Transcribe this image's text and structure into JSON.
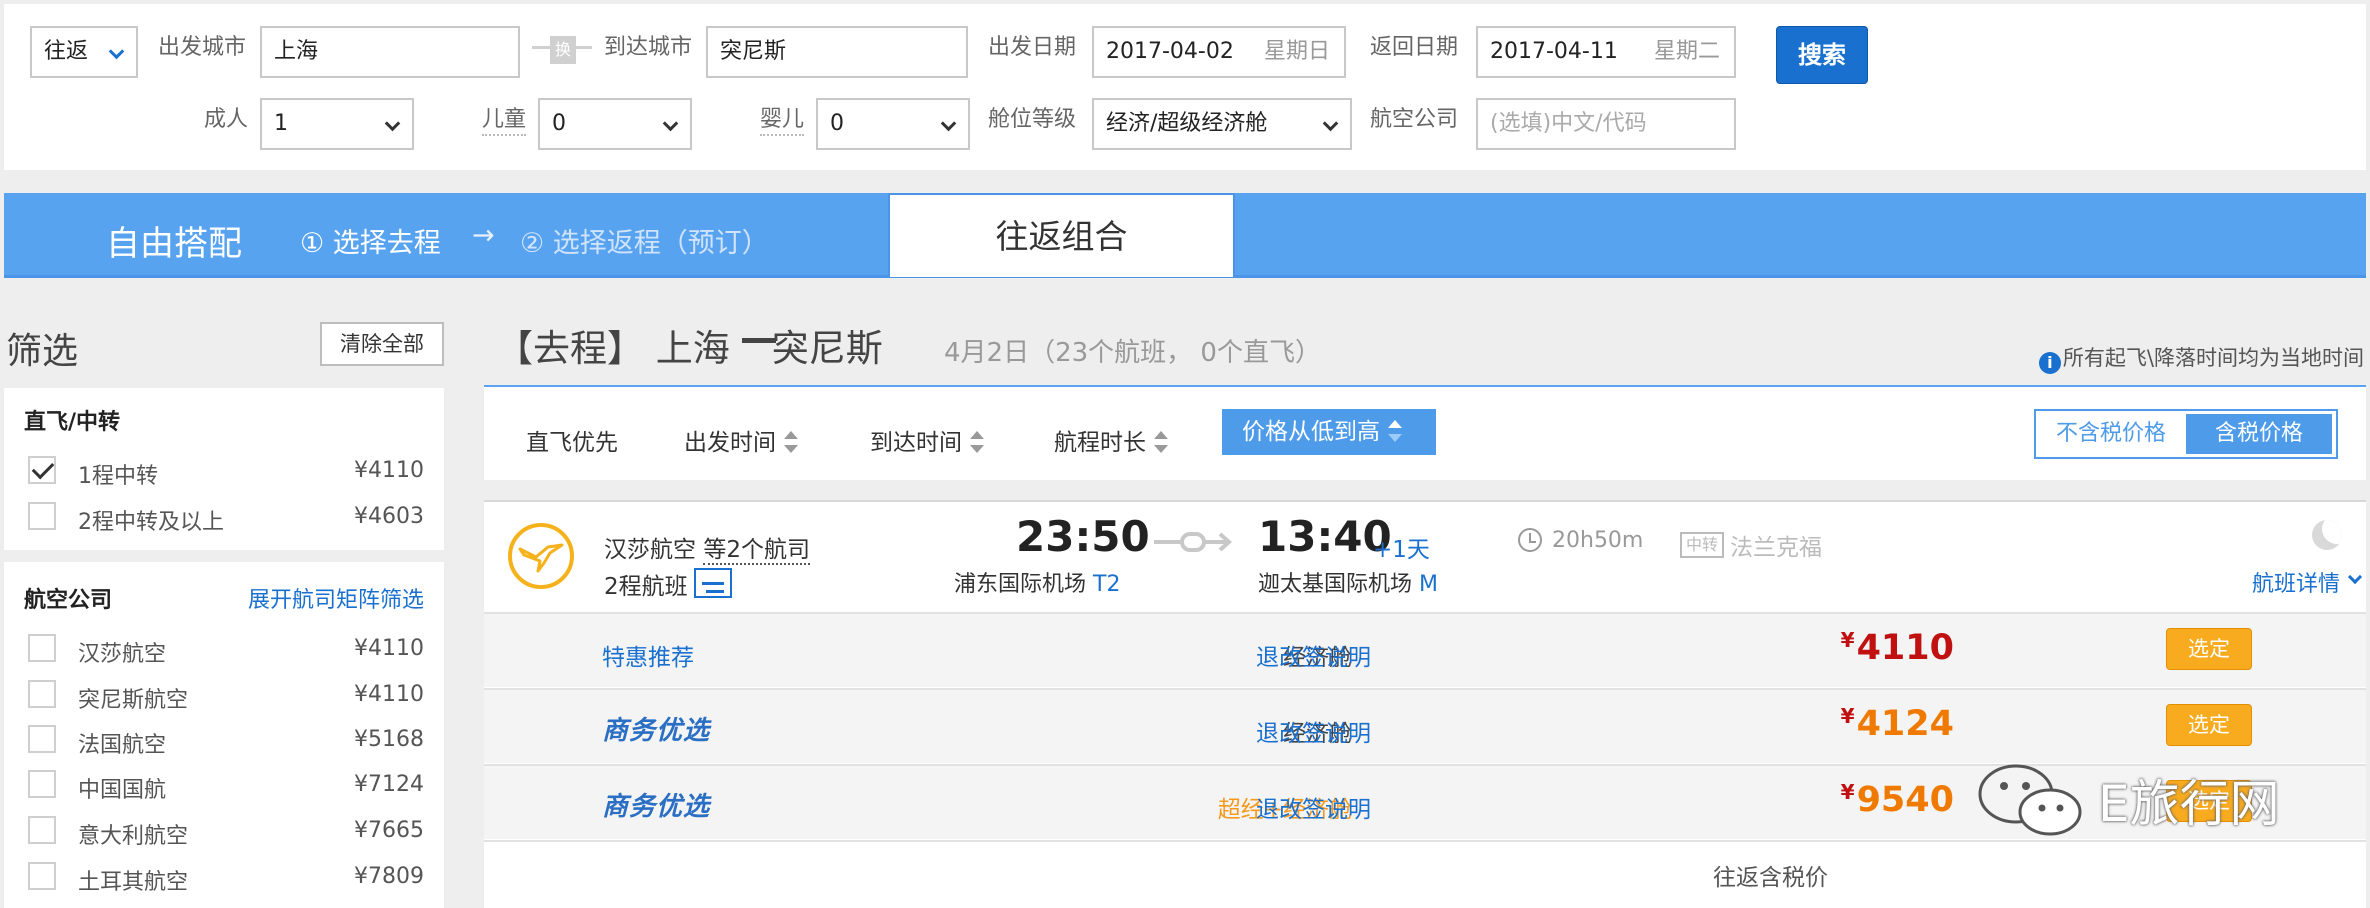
{
  "search": {
    "trip_type": "往返",
    "from_label": "出发城市",
    "from_value": "上海",
    "swap_label": "换",
    "to_label": "到达城市",
    "to_value": "突尼斯",
    "depart_label": "出发日期",
    "depart_date": "2017-04-02",
    "depart_weekday": "星期日",
    "return_label": "返回日期",
    "return_date": "2017-04-11",
    "return_weekday": "星期二",
    "search_button": "搜索",
    "adult_label": "成人",
    "adult_value": "1",
    "child_label": "儿童",
    "child_value": "0",
    "infant_label": "婴儿",
    "infant_value": "0",
    "cabin_label": "舱位等级",
    "cabin_value": "经济/超级经济舱",
    "airline_label": "航空公司",
    "airline_placeholder": "(选填)中文/代码"
  },
  "tabs": {
    "free_match": "自由搭配",
    "step1": "① 选择去程",
    "arrow": "→",
    "step2": "② 选择返程（预订）",
    "round_trip": "往返组合"
  },
  "filter": {
    "title": "筛选",
    "clear_all": "清除全部",
    "stops_title": "直飞/中转",
    "stops": [
      {
        "label": "1程中转",
        "price": "¥4110",
        "checked": true
      },
      {
        "label": "2程中转及以上",
        "price": "¥4603",
        "checked": false
      }
    ],
    "airlines_title": "航空公司",
    "airlines_matrix_link": "展开航司矩阵筛选",
    "airlines": [
      {
        "label": "汉莎航空",
        "price": "¥4110"
      },
      {
        "label": "突尼斯航空",
        "price": "¥4110"
      },
      {
        "label": "法国航空",
        "price": "¥5168"
      },
      {
        "label": "中国国航",
        "price": "¥7124"
      },
      {
        "label": "意大利航空",
        "price": "¥7665"
      },
      {
        "label": "土耳其航空",
        "price": "¥7809"
      }
    ]
  },
  "results": {
    "title_prefix": "【去程】 上海",
    "title_dest": "突尼斯",
    "subtitle": "4月2日（23个航班， 0个直飞）",
    "timezone_note": "所有起飞\\降落时间均为当地时间",
    "info_icon_glyph": "i"
  },
  "sort": {
    "direct_first": "直飞优先",
    "depart_time": "出发时间",
    "arrive_time": "到达时间",
    "duration": "航程时长",
    "price_low_high": "价格从低到高",
    "price_excl_tax": "不含税价格",
    "price_incl_tax": "含税价格"
  },
  "flight": {
    "airline": "汉莎航空",
    "airline_more": "等2个航司",
    "legs": "2程航班",
    "dep_time": "23:50",
    "dep_airport": "浦东国际机场",
    "dep_terminal": "T2",
    "arr_time": "13:40",
    "arr_plusday": "+1天",
    "arr_airport": "迦太基国际机场",
    "arr_terminal": "M",
    "duration": "20h50m",
    "transfer_badge": "中转",
    "transfer_city": "法兰克福",
    "detail_link": "航班详情",
    "fares": [
      {
        "tag": "特惠推荐",
        "tag_style": "plain",
        "cabin": "经济舱",
        "cabin_style": "normal",
        "rules": "退改签说明",
        "currency": "¥",
        "price": "4110",
        "price_color": "#c01010",
        "button": "选定"
      },
      {
        "tag": "商务优选",
        "tag_style": "biz",
        "cabin": "经济舱",
        "cabin_style": "normal",
        "rules": "退改签说明",
        "currency": "¥",
        "price": "4124",
        "price_color": "#f07a00",
        "button": "选定"
      },
      {
        "tag": "商务优选",
        "tag_style": "biz",
        "cabin": "超经+经济舱",
        "cabin_style": "orange",
        "rules": "退改签说明",
        "currency": "¥",
        "price": "9540",
        "price_color": "#f07a00",
        "button": "选定"
      }
    ],
    "tax_note": "往返含税价"
  },
  "watermark": "E旅行网",
  "colors": {
    "accent_blue": "#1a70cf",
    "tab_blue": "#58a3f0",
    "price_red": "#c01010",
    "price_orange": "#f07a00",
    "button_orange": "#f9ab1f"
  }
}
